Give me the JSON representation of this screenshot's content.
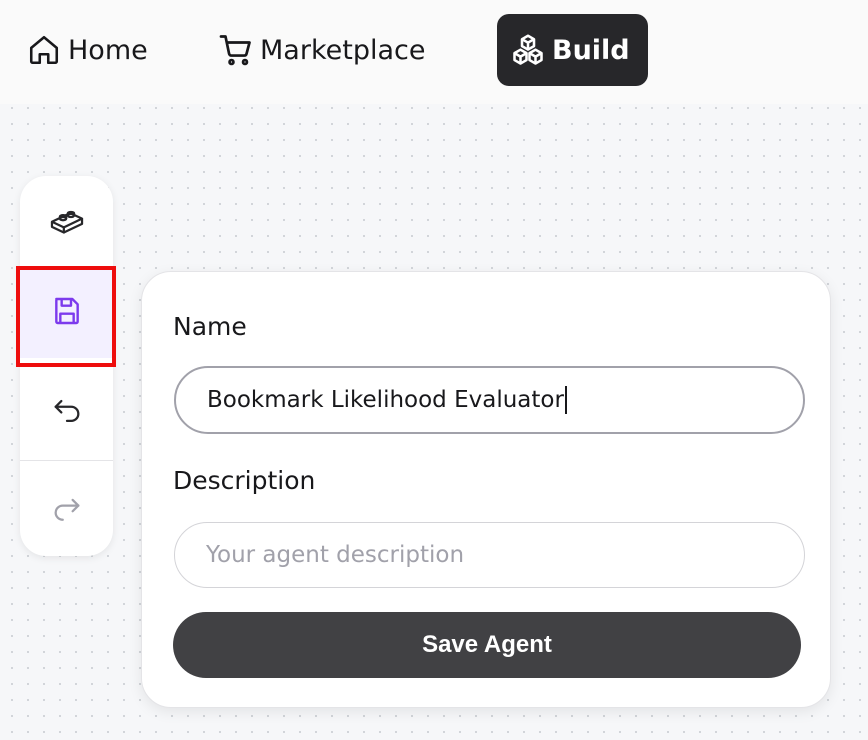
{
  "nav": {
    "items": [
      {
        "label": "Home",
        "icon": "home-icon"
      },
      {
        "label": "Marketplace",
        "icon": "cart-icon"
      },
      {
        "label": "Build",
        "icon": "blocks-icon",
        "active": true
      }
    ]
  },
  "toolbar": {
    "items": [
      {
        "icon": "block-icon",
        "name": "blocks"
      },
      {
        "icon": "save-icon",
        "name": "save",
        "active": true
      },
      {
        "icon": "undo-icon",
        "name": "undo"
      },
      {
        "icon": "redo-icon",
        "name": "redo"
      }
    ]
  },
  "save_panel": {
    "name_label": "Name",
    "name_value": "Bookmark Likelihood Evaluator",
    "description_label": "Description",
    "description_placeholder": "Your agent description",
    "save_button": "Save Agent"
  },
  "colors": {
    "active_nav_bg": "#27272a",
    "save_icon_accent": "#7c3aed",
    "highlight_border": "#ee0d0d",
    "save_button_bg": "#414144"
  }
}
